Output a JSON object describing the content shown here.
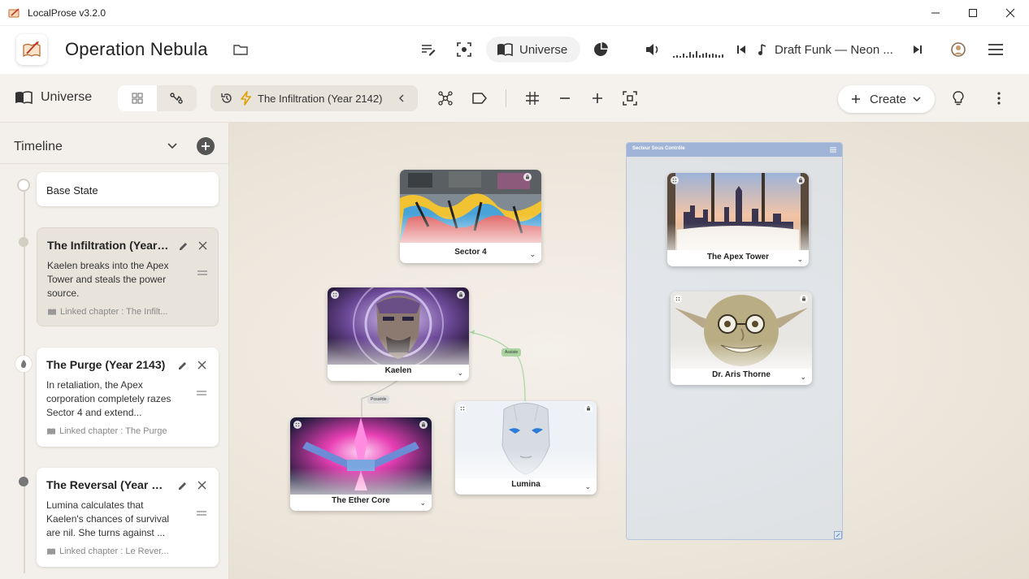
{
  "app": {
    "title": "LocalProse v3.2.0"
  },
  "header": {
    "project_title": "Operation Nebula",
    "universe_tab_label": "Universe",
    "player": {
      "track_title": "Draft Funk — Neon ..."
    }
  },
  "toolbar": {
    "section_label": "Universe",
    "active_timeline_state": "The Infiltration (Year 2142)",
    "create_label": "Create"
  },
  "sidebar": {
    "title": "Timeline",
    "items": [
      {
        "title": "Base State"
      },
      {
        "title": "The Infiltration (Year ...",
        "description": "Kaelen breaks into the Apex Tower and steals the power source.",
        "link": "Linked chapter : The Infilt..."
      },
      {
        "title": "The Purge (Year 2143)",
        "description": "In retaliation, the Apex corporation completely razes Sector 4 and extend...",
        "link": "Linked chapter : The Purge"
      },
      {
        "title": "The Reversal (Year 21...",
        "description": "Lumina calculates that Kaelen's chances of survival are nil. She turns against ...",
        "link": "Linked chapter : Le Rever..."
      }
    ]
  },
  "canvas": {
    "group": {
      "label": "Secteur Sous Contrôle"
    },
    "entities": [
      {
        "name": "Sector 4"
      },
      {
        "name": "Kaelen"
      },
      {
        "name": "The Ether Core"
      },
      {
        "name": "Lumina"
      },
      {
        "name": "The Apex Tower"
      },
      {
        "name": "Dr. Aris Thorne"
      }
    ],
    "relations": [
      {
        "label": "Possède"
      },
      {
        "label": "Assiste"
      }
    ]
  },
  "colors": {
    "accent": "#f2a900",
    "group_header": "#9fb4d6",
    "relation_green": "#a9d4a0"
  }
}
